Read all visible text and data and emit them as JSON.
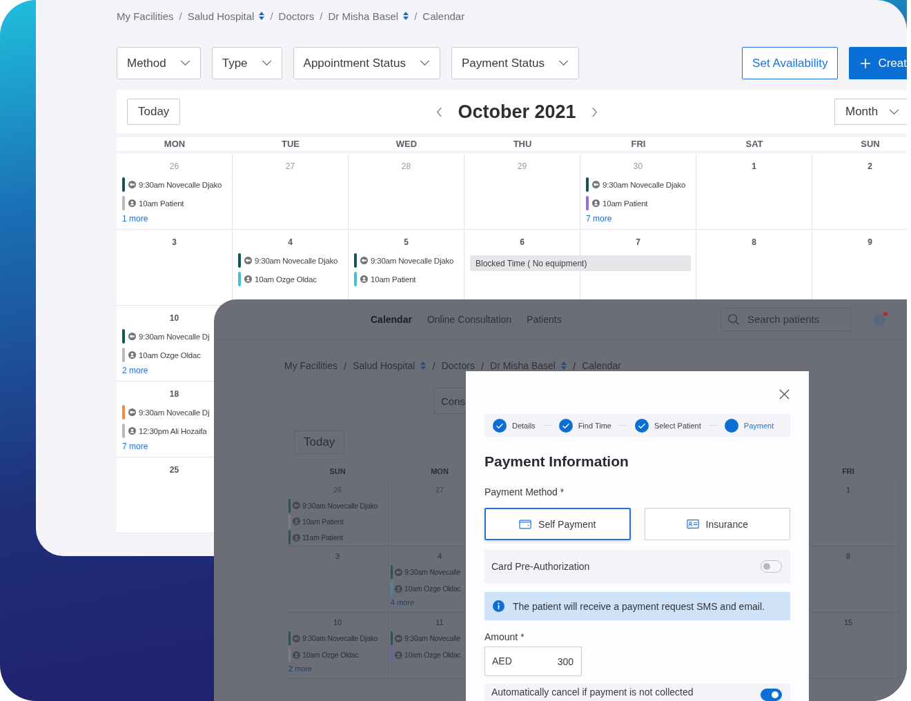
{
  "back_window": {
    "breadcrumb": [
      {
        "label": "My Facilities",
        "kind": "link"
      },
      {
        "label": "/",
        "kind": "separator"
      },
      {
        "label": "Salud Hospital",
        "kind": "switcher"
      },
      {
        "label": "/",
        "kind": "separator"
      },
      {
        "label": "Doctors",
        "kind": "link"
      },
      {
        "label": "/",
        "kind": "separator"
      },
      {
        "label": "Dr Misha Basel",
        "kind": "switcher"
      },
      {
        "label": "/",
        "kind": "separator"
      },
      {
        "label": "Calendar",
        "kind": "link"
      }
    ],
    "filters": [
      "Method",
      "Type",
      "Appointment Status",
      "Payment Status"
    ],
    "actions": [
      {
        "label": "Set Availability",
        "kind": "outline"
      },
      {
        "label": "Creat",
        "kind": "primary"
      }
    ],
    "calendar": {
      "today": "Today",
      "title": "October 2021",
      "view": "Month",
      "weekdays": [
        "MON",
        "TUE",
        "WED",
        "THU",
        "FRI",
        "SAT",
        "SUN"
      ],
      "weeks": [
        {
          "days": [
            {
              "date": "26",
              "muted": true,
              "events": [
                {
                  "text": "9:30am Novecalle Djako",
                  "kind": "video",
                  "color": "#14545c"
                },
                {
                  "text": "10am Patient",
                  "kind": "person",
                  "color": "#b9b9bd"
                }
              ],
              "more": "1 more"
            },
            {
              "date": "27",
              "muted": true
            },
            {
              "date": "28",
              "muted": true
            },
            {
              "date": "29",
              "muted": true
            },
            {
              "date": "30",
              "muted": true,
              "events": [
                {
                  "text": "9:30am Novecalle Djako",
                  "kind": "video",
                  "color": "#14545c"
                },
                {
                  "text": "10am Patient",
                  "kind": "person",
                  "color": "#9b6be3"
                }
              ],
              "more": "7 more"
            },
            {
              "date": "1",
              "muted": false
            },
            {
              "date": "2",
              "muted": false
            }
          ]
        },
        {
          "days": [
            {
              "date": "3",
              "muted": false
            },
            {
              "date": "4",
              "muted": false,
              "events": [
                {
                  "text": "9:30am Novecalle Djako",
                  "kind": "video",
                  "color": "#14545c"
                },
                {
                  "text": "10am Ozge Oldac",
                  "kind": "person",
                  "color": "#3ec4d6"
                }
              ]
            },
            {
              "date": "5",
              "muted": false,
              "events": [
                {
                  "text": "9:30am Novecalle Djako",
                  "kind": "video",
                  "color": "#14545c"
                },
                {
                  "text": "10am Patient",
                  "kind": "person",
                  "color": "#3ec4d6"
                }
              ]
            },
            {
              "date": "6",
              "muted": false,
              "blocked": "Blocked Time ( No equipment)"
            },
            {
              "date": "7",
              "muted": false
            },
            {
              "date": "8",
              "muted": false
            },
            {
              "date": "9",
              "muted": false
            }
          ]
        },
        {
          "days": [
            {
              "date": "10",
              "muted": false,
              "events": [
                {
                  "text": "9:30am Novecalle Dj",
                  "kind": "video",
                  "color": "#0f5a4f"
                },
                {
                  "text": "10am Ozge Oldac",
                  "kind": "person",
                  "color": "#b9b9bd"
                }
              ],
              "more": "2 more"
            }
          ]
        },
        {
          "days": [
            {
              "date": "18",
              "muted": false,
              "events": [
                {
                  "text": "9:30am Novecalle Dj",
                  "kind": "video",
                  "color": "#f58a3a"
                },
                {
                  "text": "12:30pm Ali Hozaifa",
                  "kind": "person",
                  "color": "#b9b9bd"
                }
              ],
              "more": "7 more"
            }
          ]
        },
        {
          "days": [
            {
              "date": "25",
              "muted": false
            }
          ]
        }
      ]
    }
  },
  "front_window": {
    "nav": [
      {
        "label": "Calendar",
        "selected": true
      },
      {
        "label": "Online Consultation",
        "selected": false
      },
      {
        "label": "Patients",
        "selected": false
      }
    ],
    "search": {
      "placeholder": "Search patients"
    },
    "breadcrumb": [
      {
        "label": "My Facilities",
        "kind": "link"
      },
      {
        "label": "/",
        "kind": "separator"
      },
      {
        "label": "Salud Hospital",
        "kind": "switcher"
      },
      {
        "label": "/",
        "kind": "separator"
      },
      {
        "label": "Doctors",
        "kind": "link"
      },
      {
        "label": "/",
        "kind": "separator"
      },
      {
        "label": "Dr Misha Basel",
        "kind": "switcher"
      },
      {
        "label": "/",
        "kind": "separator"
      },
      {
        "label": "Calendar",
        "kind": "link"
      }
    ],
    "consultation_button": "Cons",
    "today": "Today",
    "weekdays": [
      "SUN",
      "MON",
      "FRI"
    ],
    "weeks": [
      {
        "days": [
          {
            "date": "26",
            "muted": true,
            "events": [
              {
                "text": "9:30am Novecalle Djako",
                "kind": "video",
                "color": "#2f5258"
              },
              {
                "text": "10am Patient",
                "kind": "person",
                "color": "#7c7e84"
              },
              {
                "text": "11am Patient",
                "kind": "person",
                "color": "#2f5258"
              }
            ]
          },
          {
            "date": "27",
            "muted": true
          },
          {
            "date": "1",
            "muted": false
          }
        ]
      },
      {
        "days": [
          {
            "date": "3",
            "muted": false
          },
          {
            "date": "4",
            "muted": false,
            "events": [
              {
                "text": "9:30am Novecalle",
                "kind": "video",
                "color": "#2f5258"
              },
              {
                "text": "10am Ozge Oldac",
                "kind": "person",
                "color": "#4f8890"
              }
            ],
            "more": "4 more"
          },
          {
            "date": "8",
            "muted": false
          }
        ]
      },
      {
        "days": [
          {
            "date": "10",
            "muted": false,
            "events": [
              {
                "text": "9:30am Novecalle Djako",
                "kind": "video",
                "color": "#2f5258"
              },
              {
                "text": "10am Ozge Oldac",
                "kind": "person",
                "color": "#7c7e84"
              }
            ],
            "more": "2 more"
          },
          {
            "date": "11",
            "muted": false,
            "events": [
              {
                "text": "9:30am Novecalle",
                "kind": "video",
                "color": "#2f5258"
              },
              {
                "text": "10am Ozge Oldac",
                "kind": "person",
                "color": "#6a63a0"
              }
            ]
          },
          {
            "date": "15",
            "muted": false
          }
        ]
      }
    ]
  },
  "modal": {
    "steps": [
      {
        "label": "Details",
        "done": true
      },
      {
        "label": "Find Time",
        "done": true
      },
      {
        "label": "Select Patient",
        "done": true
      },
      {
        "label": "Payment",
        "done": false
      }
    ],
    "title": "Payment Information",
    "method_label": "Payment Method *",
    "methods": [
      {
        "label": "Self Payment",
        "kind": "wallet",
        "selected": true
      },
      {
        "label": "Insurance",
        "kind": "card",
        "selected": false
      }
    ],
    "pre_authorization": {
      "label": "Card Pre-Authorization",
      "on": false
    },
    "info": "The patient will receive a payment request SMS and email.",
    "amount": {
      "label": "Amount *",
      "currency": "AED",
      "value": "300"
    },
    "auto_cancel": {
      "label": "Automatically cancel if payment is not collected",
      "on": true
    }
  }
}
